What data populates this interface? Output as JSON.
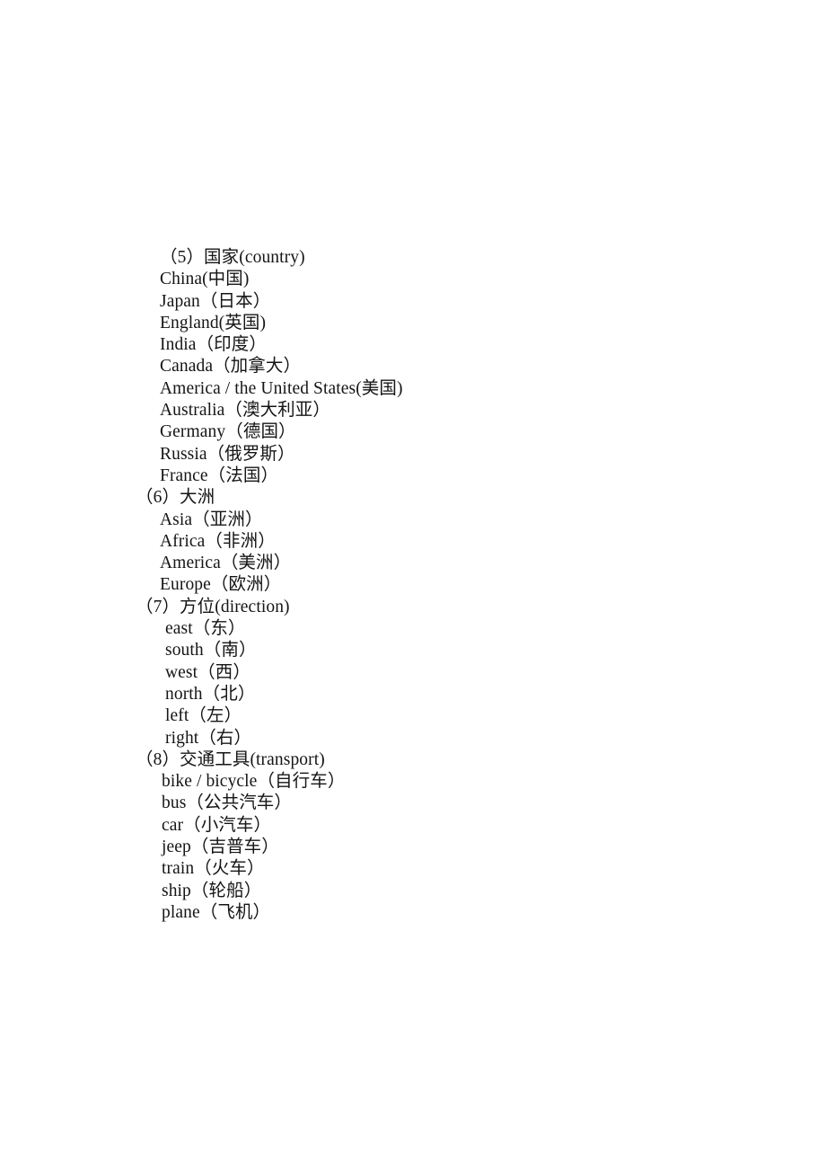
{
  "document": {
    "page_background": "#ffffff",
    "text_color": "#151515",
    "sections": [
      {
        "heading": "（5）国家(country)",
        "heading_indent": "heading-a",
        "item_indent": "item-a",
        "items": [
          "China(中国)",
          "Japan（日本）",
          "England(英国)",
          "India（印度）",
          "Canada（加拿大）",
          "America / the United States(美国)",
          "Australia（澳大利亚）",
          "Germany（德国）",
          "Russia（俄罗斯）",
          "France（法国）"
        ]
      },
      {
        "heading": "（6）大洲",
        "heading_indent": "heading-b",
        "item_indent": "item-a",
        "items": [
          "Asia（亚洲）",
          "Africa（非洲）",
          "America（美洲）",
          "Europe（欧洲）"
        ]
      },
      {
        "heading": "（7）方位(direction)",
        "heading_indent": "heading-b",
        "item_indent": "item-b",
        "items": [
          "east（东）",
          "south（南）",
          "west（西）",
          "north（北）",
          "left（左）",
          "right（右）"
        ]
      },
      {
        "heading": "（8）交通工具(transport)",
        "heading_indent": "heading-b",
        "item_indent": "item-c",
        "items": [
          "bike / bicycle（自行车）",
          "bus（公共汽车）",
          "car（小汽车）",
          "jeep（吉普车）",
          "train（火车）",
          "ship（轮船）",
          "plane（飞机）"
        ]
      }
    ]
  }
}
